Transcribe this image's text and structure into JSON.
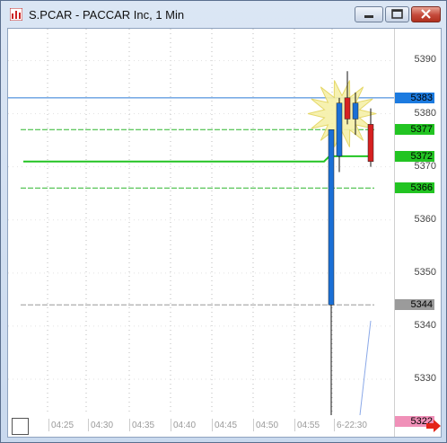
{
  "window": {
    "title": "S.PCAR - PACCAR Inc, 1 Min",
    "icon": "chart-icon"
  },
  "chart_data": {
    "type": "candlestick",
    "symbol": "S.PCAR",
    "interval": "1 Min",
    "y_ticks": [
      5390,
      5380,
      5370,
      5360,
      5350,
      5340,
      5330
    ],
    "ylim": [
      5319,
      5396
    ],
    "x_ticks": [
      "04:25",
      "04:30",
      "04:35",
      "04:40",
      "04:45",
      "04:50",
      "04:55",
      "6-22:30"
    ],
    "candles": [
      {
        "open": 5344,
        "high": 5376,
        "low": 5320,
        "close": 5377,
        "color": "#1a6fd6"
      },
      {
        "open": 5372,
        "high": 5383,
        "low": 5369,
        "close": 5382,
        "color": "#1a6fd6"
      },
      {
        "open": 5383,
        "high": 5388,
        "low": 5378,
        "close": 5379,
        "color": "#d62020"
      },
      {
        "open": 5379,
        "high": 5384,
        "low": 5376,
        "close": 5382,
        "color": "#1a6fd6"
      },
      {
        "open": 5378,
        "high": 5381,
        "low": 5370,
        "close": 5371,
        "color": "#d62020"
      }
    ],
    "levels": [
      {
        "value": 5383,
        "label": "5383",
        "line_color": "#2a7ad8",
        "tag_color": "#1c7be0",
        "style": "solid"
      },
      {
        "value": 5377,
        "label": "5377",
        "line_color": "#2bb52b",
        "tag_color": "#22c422",
        "style": "dashed"
      },
      {
        "value": 5372,
        "label": "5372",
        "line_color": "#22c422",
        "tag_color": "#22c422",
        "style": "thick"
      },
      {
        "value": 5366,
        "label": "5366",
        "line_color": "#2bb52b",
        "tag_color": "#22c422",
        "style": "dashed"
      },
      {
        "value": 5344,
        "label": "5344",
        "line_color": "#999999",
        "tag_color": "#9b9b9b",
        "style": "dashed"
      },
      {
        "value": 5322,
        "label": "5322",
        "line_color": "#e36aa0",
        "tag_color": "#f090b8",
        "style": "dashed"
      }
    ]
  }
}
